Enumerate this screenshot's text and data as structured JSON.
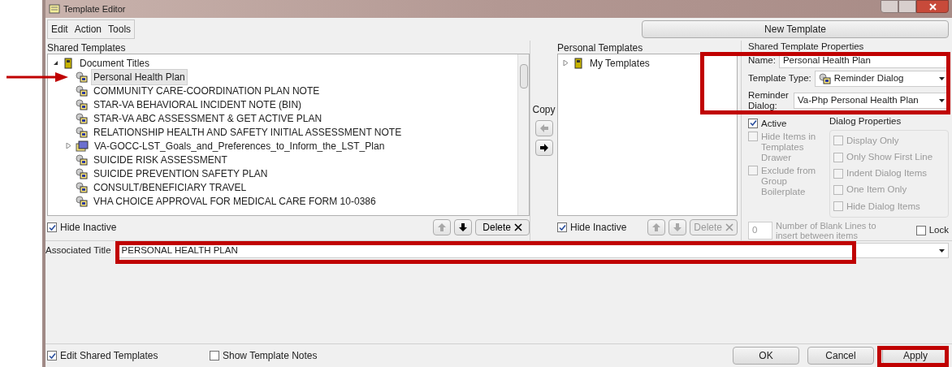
{
  "window": {
    "title": "Template Editor"
  },
  "menu": [
    {
      "label": "Edit"
    },
    {
      "label": "Action"
    },
    {
      "label": "Tools"
    }
  ],
  "new_template_button": "New Template",
  "shared": {
    "label": "Shared Templates",
    "tree": [
      {
        "label": "Document Titles",
        "kind": "folder",
        "expanded": true,
        "selected": false,
        "children": [
          {
            "label": "Personal Health Plan",
            "kind": "template",
            "selected": true
          },
          {
            "label": "COMMUNITY CARE-COORDINATION PLAN NOTE",
            "kind": "template",
            "selected": false
          },
          {
            "label": "STAR-VA BEHAVIORAL INCIDENT NOTE (BIN)",
            "kind": "template",
            "selected": false
          },
          {
            "label": "STAR-VA ABC ASSESSMENT & GET ACTIVE PLAN",
            "kind": "template",
            "selected": false
          },
          {
            "label": "RELATIONSHIP HEALTH AND SAFETY INITIAL ASSESSMENT NOTE",
            "kind": "template",
            "selected": false
          },
          {
            "label": "VA-GOCC-LST_Goals_and_Preferences_to_Inform_the_LST_Plan",
            "kind": "group",
            "expanded": false,
            "selected": false
          },
          {
            "label": "SUICIDE RISK ASSESSMENT",
            "kind": "template",
            "selected": false
          },
          {
            "label": "SUICIDE PREVENTION SAFETY PLAN",
            "kind": "template",
            "selected": false
          },
          {
            "label": "CONSULT/BENEFICIARY TRAVEL",
            "kind": "template",
            "selected": false
          },
          {
            "label": "VHA CHOICE APPROVAL FOR MEDICAL CARE FORM 10-0386",
            "kind": "template",
            "selected": false
          }
        ]
      }
    ],
    "hide_inactive": {
      "label": "Hide Inactive",
      "checked": true
    },
    "up_disabled": true,
    "down_disabled": false,
    "delete": {
      "label": "Delete",
      "disabled": false
    }
  },
  "copy": {
    "label": "Copy",
    "left_disabled": true,
    "right_disabled": false
  },
  "personal": {
    "label": "Personal Templates",
    "tree": [
      {
        "label": "My Templates",
        "kind": "folder",
        "expanded": false,
        "selected": false
      }
    ],
    "hide_inactive": {
      "label": "Hide Inactive",
      "checked": true
    },
    "up_disabled": true,
    "down_disabled": true,
    "delete": {
      "label": "Delete",
      "disabled": true
    }
  },
  "properties": {
    "title": "Shared Template Properties",
    "name_label": "Name:",
    "name_value": "Personal Health Plan",
    "type_label": "Template Type:",
    "type_value": "Reminder Dialog",
    "dialog_label": "Reminder Dialog:",
    "dialog_value": "Va-Php Personal Health Plan",
    "options": [
      {
        "label": "Active",
        "checked": true,
        "disabled": false
      },
      {
        "label": "Hide Items in Templates Drawer",
        "checked": false,
        "disabled": true
      },
      {
        "label": "Exclude from Group Boilerplate",
        "checked": false,
        "disabled": true
      }
    ],
    "dialog_properties": {
      "title": "Dialog Properties",
      "options": [
        {
          "label": "Display Only",
          "checked": false
        },
        {
          "label": "Only Show First Line",
          "checked": false
        },
        {
          "label": "Indent Dialog Items",
          "checked": false
        },
        {
          "label": "One Item Only",
          "checked": false
        },
        {
          "label": "Hide Dialog Items",
          "checked": false
        }
      ]
    },
    "blank_lines_value": "0",
    "blank_lines_label": "Number of Blank Lines to insert between items",
    "lock": {
      "label": "Lock",
      "checked": false
    }
  },
  "associated_title": {
    "label": "Associated Title",
    "value": "PERSONAL HEALTH PLAN"
  },
  "footer": {
    "edit_shared": {
      "label": "Edit Shared Templates",
      "checked": true
    },
    "show_notes": {
      "label": "Show Template Notes",
      "checked": false
    },
    "buttons": [
      "OK",
      "Cancel",
      "Apply"
    ]
  }
}
